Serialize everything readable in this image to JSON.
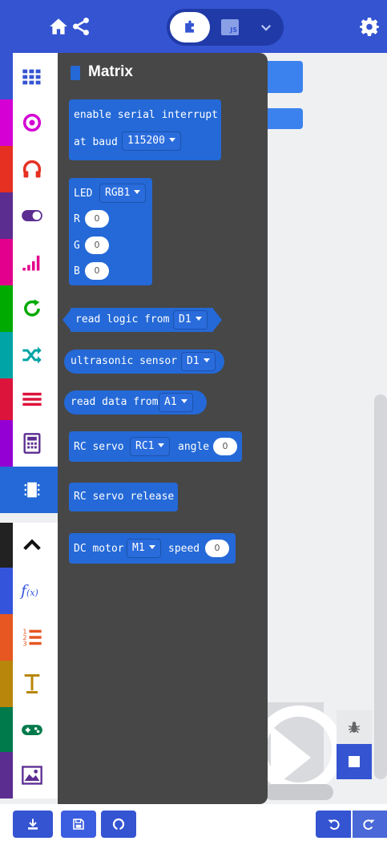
{
  "header": {
    "home_icon": "home-icon",
    "share_icon": "share-icon",
    "blocks_icon": "puzzle-icon",
    "js_label": "JS",
    "more_icon": "chevron-down-icon",
    "settings_icon": "gear-icon"
  },
  "categories": [
    {
      "name": "grid",
      "strip": "#3454d1"
    },
    {
      "name": "input",
      "strip": "#d400d4"
    },
    {
      "name": "music",
      "strip": "#e63022"
    },
    {
      "name": "led",
      "strip": "#5c2d91"
    },
    {
      "name": "radio",
      "strip": "#e3008c"
    },
    {
      "name": "loops",
      "strip": "#00aa00"
    },
    {
      "name": "logic",
      "strip": "#00a4a6"
    },
    {
      "name": "variables",
      "strip": "#dc143c"
    },
    {
      "name": "math",
      "strip": "#9400d3"
    },
    {
      "name": "matrix",
      "strip": "#2469d7"
    },
    {
      "name": "advanced",
      "strip": "#222222"
    },
    {
      "name": "functions",
      "strip": "#3455db"
    },
    {
      "name": "arrays",
      "strip": "#e65722"
    },
    {
      "name": "text",
      "strip": "#b8860b"
    },
    {
      "name": "game",
      "strip": "#007a4b"
    },
    {
      "name": "images",
      "strip": "#5c2d91"
    }
  ],
  "flyout": {
    "title": "Matrix",
    "serial_line1": "enable serial interrupt",
    "serial_line2": "at baud",
    "baud_value": "115200",
    "led_label": "LED",
    "led_value": "RGB1",
    "r_label": "R",
    "r_value": "0",
    "g_label": "G",
    "g_value": "0",
    "b_label": "B",
    "b_value": "0",
    "logic_label": "read logic from",
    "logic_value": "D1",
    "ultra_label": "ultrasonic sensor",
    "ultra_value": "D1",
    "data_label": "read data from",
    "data_value": "A1",
    "servo_label": "RC servo",
    "servo_value": "RC1",
    "angle_label": "angle",
    "angle_value": "0",
    "release_label": "RC servo release",
    "motor_label": "DC motor",
    "motor_value": "M1",
    "speed_label": "speed",
    "speed_value": "0"
  },
  "toolbar": {
    "download_icon": "download-icon",
    "save_icon": "save-icon",
    "github_icon": "github-icon",
    "undo_icon": "undo-icon",
    "redo_icon": "redo-icon"
  }
}
